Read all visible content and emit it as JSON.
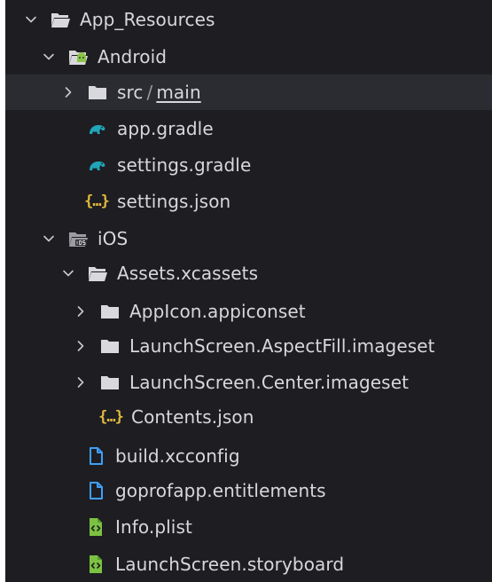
{
  "tree": {
    "app_resources": "App_Resources",
    "android": "Android",
    "src": "src",
    "src_sep": "/",
    "main": "main",
    "app_gradle": "app.gradle",
    "settings_gradle": "settings.gradle",
    "settings_json": "settings.json",
    "json_icon_text": "{…}",
    "ios": "iOS",
    "assets": "Assets.xcassets",
    "appicon": "AppIcon.appiconset",
    "launch_aspectfill": "LaunchScreen.AspectFill.imageset",
    "launch_center": "LaunchScreen.Center.imageset",
    "contents_json": "Contents.json",
    "build_xcconfig": "build.xcconfig",
    "entitlements": "goprofapp.entitlements",
    "info_plist": "Info.plist",
    "launch_storyboard": "LaunchScreen.storyboard"
  },
  "colors": {
    "background": "#1e1e22",
    "selected_row": "#2b2c31",
    "text": "#d8d8db",
    "folder": "#d9d9dd",
    "android_green": "#8bc34a",
    "gradle_teal": "#21a5b8",
    "json_yellow": "#e2b93d",
    "file_blue": "#3f9ff5",
    "plist_green": "#7cc242"
  }
}
